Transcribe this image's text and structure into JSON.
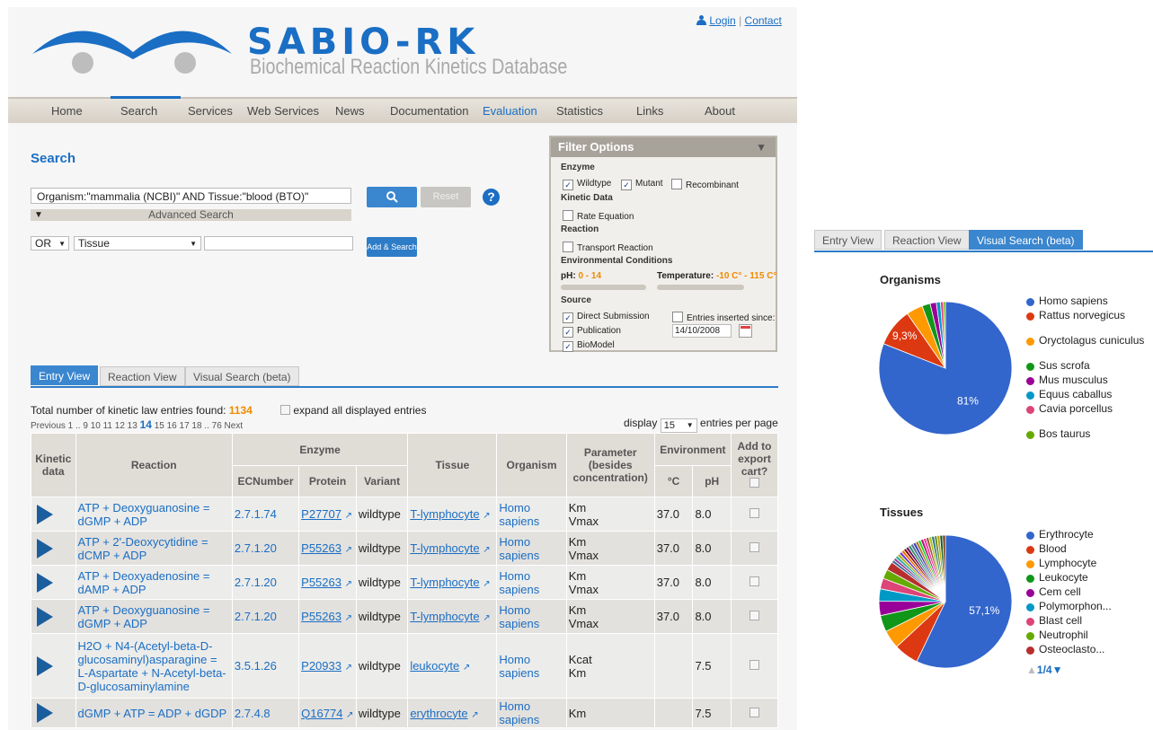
{
  "header": {
    "title": "SABIO-RK",
    "subtitle": "Biochemical Reaction Kinetics Database",
    "login": "Login",
    "contact": "Contact",
    "separator": "|"
  },
  "nav": {
    "items": [
      "Home",
      "Search",
      "Services",
      "Web Services",
      "News",
      "Documentation",
      "Evaluation",
      "Statistics",
      "Links",
      "About"
    ],
    "active": "Search",
    "highlight": "Evaluation"
  },
  "search": {
    "heading": "Search",
    "query": "Organism:\"mammalia (NCBI)\" AND Tissue:\"blood (BTO)\"",
    "advanced": "Advanced Search",
    "reset": "Reset",
    "help": "?",
    "operator": "OR",
    "field": "Tissue",
    "term": "",
    "add_search": "Add & Search"
  },
  "filter": {
    "title": "Filter Options",
    "enzyme_label": "Enzyme",
    "wildtype": "Wildtype",
    "mutant": "Mutant",
    "recombinant": "Recombinant",
    "kinetic_label": "Kinetic Data",
    "rate_equation": "Rate Equation",
    "reaction_label": "Reaction",
    "transport": "Transport Reaction",
    "env_label": "Environmental Conditions",
    "ph_label": "pH:",
    "ph_range": "0 - 14",
    "temp_label": "Temperature:",
    "temp_range": "-10 C° - 115 C°",
    "source_label": "Source",
    "direct": "Direct Submission",
    "publication": "Publication",
    "biomodel": "BioModel",
    "inserted_since": "Entries inserted since:",
    "date": "14/10/2008"
  },
  "tabs": [
    "Entry View",
    "Reaction View",
    "Visual Search (beta)"
  ],
  "results": {
    "total_label": "Total number of kinetic law entries found:",
    "total": "1134",
    "expand": "expand all displayed entries",
    "pagination": "Previous 1 .. 9 10 11 12 13",
    "current_page": "14",
    "pagination_after": "15 16 17 18 .. 76 Next",
    "display_label": "display",
    "per_page": "15",
    "per_page_label": "entries per page"
  },
  "table": {
    "headers": {
      "kinetic": "Kinetic data",
      "reaction": "Reaction",
      "enzyme": "Enzyme",
      "ecnumber": "ECNumber",
      "protein": "Protein",
      "variant": "Variant",
      "tissue": "Tissue",
      "organism": "Organism",
      "parameter": "Parameter (besides concentration)",
      "environment": "Environment",
      "temp": "°C",
      "ph": "pH",
      "cart": "Add to export cart?"
    },
    "rows": [
      {
        "reaction": "ATP + Deoxyguanosine = dGMP + ADP",
        "ec": "2.7.1.74",
        "protein": "P27707",
        "variant": "wildtype",
        "tissue": "T-lymphocyte",
        "organism": "Homo sapiens",
        "params": "Km\nVmax",
        "temp": "37.0",
        "ph": "8.0"
      },
      {
        "reaction": "ATP + 2'-Deoxycytidine = dCMP + ADP",
        "ec": "2.7.1.20",
        "protein": "P55263",
        "variant": "wildtype",
        "tissue": "T-lymphocyte",
        "organism": "Homo sapiens",
        "params": "Km\nVmax",
        "temp": "37.0",
        "ph": "8.0"
      },
      {
        "reaction": "ATP + Deoxyadenosine = dAMP + ADP",
        "ec": "2.7.1.20",
        "protein": "P55263",
        "variant": "wildtype",
        "tissue": "T-lymphocyte",
        "organism": "Homo sapiens",
        "params": "Km\nVmax",
        "temp": "37.0",
        "ph": "8.0"
      },
      {
        "reaction": "ATP + Deoxyguanosine = dGMP + ADP",
        "ec": "2.7.1.20",
        "protein": "P55263",
        "variant": "wildtype",
        "tissue": "T-lymphocyte",
        "organism": "Homo sapiens",
        "params": "Km\nVmax",
        "temp": "37.0",
        "ph": "8.0"
      },
      {
        "reaction": "H2O + N4-(Acetyl-beta-D-glucosaminyl)asparagine = L-Aspartate + N-Acetyl-beta-D-glucosaminylamine",
        "ec": "3.5.1.26",
        "protein": "P20933",
        "variant": "wildtype",
        "tissue": "leukocyte",
        "organism": "Homo sapiens",
        "params": "Kcat\nKm",
        "temp": "",
        "ph": "7.5"
      },
      {
        "reaction": "dGMP + ATP = ADP + dGDP",
        "ec": "2.7.4.8",
        "protein": "Q16774",
        "variant": "wildtype",
        "tissue": "erythrocyte",
        "organism": "Homo sapiens",
        "params": "Km",
        "temp": "",
        "ph": "7.5"
      }
    ]
  },
  "visual": {
    "organisms_title": "Organisms",
    "organisms": [
      {
        "name": "Homo sapiens",
        "color": "#3366cc",
        "value": 81,
        "label": "81%"
      },
      {
        "name": "Rattus norvegicus",
        "color": "#dc3912",
        "value": 9.3,
        "label": "9,3%"
      },
      {
        "name": "Oryctolagus cuniculus",
        "color": "#ff9900",
        "value": 4.0,
        "label": ""
      },
      {
        "name": "Sus scrofa",
        "color": "#109618",
        "value": 2.0,
        "label": ""
      },
      {
        "name": "Mus musculus",
        "color": "#990099",
        "value": 1.5,
        "label": ""
      },
      {
        "name": "Equus caballus",
        "color": "#0099c6",
        "value": 1.0,
        "label": ""
      },
      {
        "name": "Cavia porcellus",
        "color": "#dd4477",
        "value": 0.7,
        "label": ""
      },
      {
        "name": "Bos taurus",
        "color": "#66aa00",
        "value": 0.5,
        "label": ""
      }
    ],
    "tissues_title": "Tissues",
    "tissues": [
      {
        "name": "Erythrocyte",
        "color": "#3366cc",
        "value": 57.1,
        "label": "57,1%"
      },
      {
        "name": "Blood",
        "color": "#dc3912",
        "value": 6,
        "label": ""
      },
      {
        "name": "Lymphocyte",
        "color": "#ff9900",
        "value": 4.5,
        "label": ""
      },
      {
        "name": "Leukocyte",
        "color": "#109618",
        "value": 4,
        "label": ""
      },
      {
        "name": "Cem cell",
        "color": "#990099",
        "value": 3.5,
        "label": ""
      },
      {
        "name": "Polymorphon...",
        "color": "#0099c6",
        "value": 3,
        "label": ""
      },
      {
        "name": "Blast cell",
        "color": "#dd4477",
        "value": 2.6,
        "label": ""
      },
      {
        "name": "Neutrophil",
        "color": "#66aa00",
        "value": 2.3,
        "label": ""
      },
      {
        "name": "Osteoclasto...",
        "color": "#b82e2e",
        "value": 2.1,
        "label": ""
      }
    ],
    "tissue_rest_colors": [
      "#316395",
      "#994499",
      "#22aa99",
      "#aaaa11",
      "#6633cc",
      "#e67300",
      "#8b0707",
      "#651067",
      "#329262",
      "#5574a6",
      "#3b3eac",
      "#b77322",
      "#16d620",
      "#b91383",
      "#f4359e",
      "#9c5935",
      "#a9c413",
      "#2a778d",
      "#668d1c",
      "#bea413",
      "#0c5922",
      "#743411"
    ],
    "pager": "1/4"
  }
}
